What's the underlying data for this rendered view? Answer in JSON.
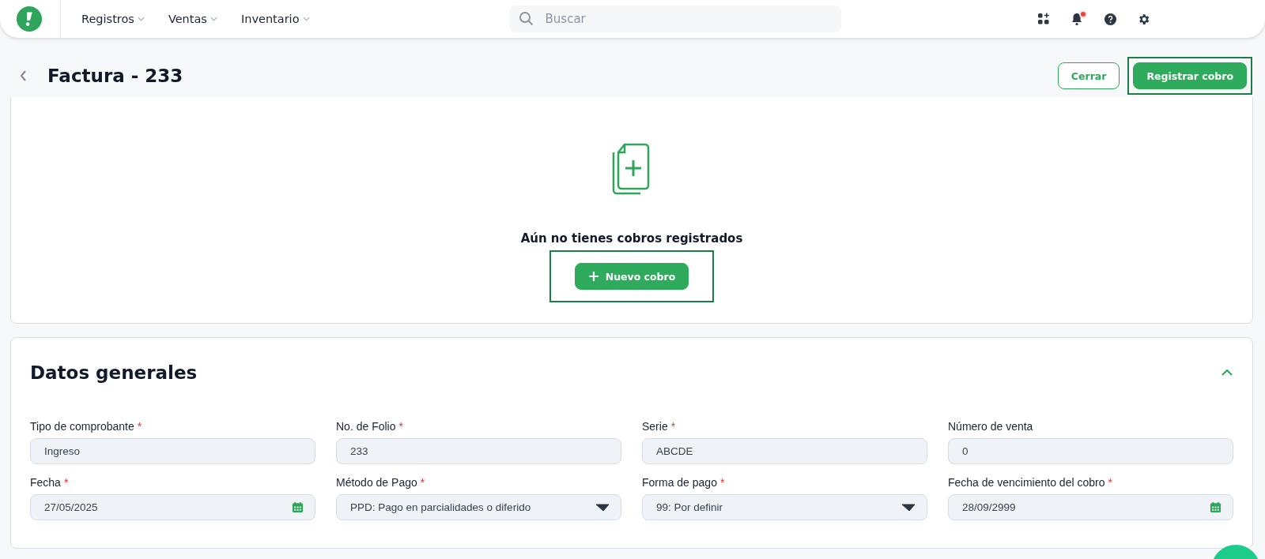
{
  "nav": {
    "menus": [
      {
        "label": "Registros"
      },
      {
        "label": "Ventas"
      },
      {
        "label": "Inventario"
      }
    ],
    "search": {
      "placeholder": "Buscar"
    },
    "notification_dot": true
  },
  "header": {
    "title": "Factura - 233",
    "buttons": [
      {
        "label": "Cerrar",
        "kind": "outline",
        "highlighted": false
      },
      {
        "label": "Registrar cobro",
        "kind": "primary",
        "highlighted": true
      }
    ]
  },
  "empty_state": {
    "message": "Aún no tienes cobros registrados",
    "button": {
      "label": "Nuevo cobro",
      "highlighted": true
    }
  },
  "general": {
    "title": "Datos generales",
    "expanded": true,
    "fields": [
      {
        "label": "Tipo de comprobante",
        "required_mark": "*",
        "kind": "text",
        "value": "Ingreso"
      },
      {
        "label": "No. de Folio",
        "required_mark": "*",
        "kind": "text",
        "value": "233"
      },
      {
        "label": "Serie",
        "required_mark": "*",
        "kind": "text",
        "value": "ABCDE"
      },
      {
        "label": "Número de venta",
        "kind": "text",
        "value": "0"
      },
      {
        "label": "Fecha",
        "required_mark": "*",
        "kind": "date",
        "value": "27/05/2025"
      },
      {
        "label": "Método de Pago",
        "required_mark": "*",
        "kind": "select",
        "value": "PPD: Pago en parcialidades o diferido"
      },
      {
        "label": "Forma de pago",
        "required_mark": "*",
        "kind": "select",
        "value": "99: Por definir"
      },
      {
        "label": "Fecha de vencimiento del cobro",
        "required_mark": "*",
        "kind": "date",
        "value": "28/09/2999"
      }
    ]
  }
}
